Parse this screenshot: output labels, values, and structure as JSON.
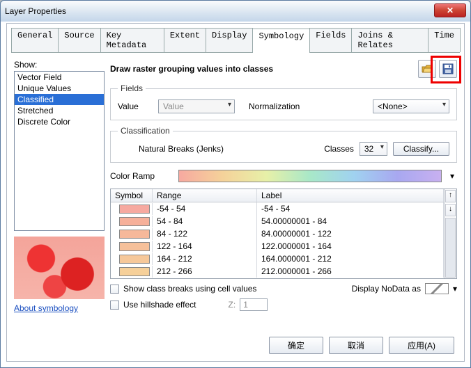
{
  "window": {
    "title": "Layer Properties"
  },
  "tabs": [
    "General",
    "Source",
    "Key Metadata",
    "Extent",
    "Display",
    "Symbology",
    "Fields",
    "Joins & Relates",
    "Time"
  ],
  "active_tab_index": 5,
  "show": {
    "label": "Show:",
    "items": [
      "Vector Field",
      "Unique Values",
      "Classified",
      "Stretched",
      "Discrete Color"
    ],
    "selected_index": 2
  },
  "about_link": "About symbology",
  "heading": "Draw raster grouping values into classes",
  "icons": {
    "open": "open-folder-icon",
    "save": "save-disk-icon"
  },
  "fields_group": {
    "legend": "Fields",
    "value_label": "Value",
    "value_selected": "Value",
    "normalization_label": "Normalization",
    "normalization_selected": "<None>"
  },
  "classification_group": {
    "legend": "Classification",
    "method": "Natural Breaks (Jenks)",
    "classes_label": "Classes",
    "classes_value": "32",
    "classify_button": "Classify..."
  },
  "color_ramp_label": "Color Ramp",
  "table": {
    "headers": {
      "symbol": "Symbol",
      "range": "Range",
      "label": "Label"
    },
    "rows": [
      {
        "color": "#f6a9a0",
        "range": "-54 - 54",
        "label": "-54 - 54"
      },
      {
        "color": "#f6b09a",
        "range": "54 - 84",
        "label": "54.00000001 - 84"
      },
      {
        "color": "#f6b89a",
        "range": "84 - 122",
        "label": "84.00000001 - 122"
      },
      {
        "color": "#f6c09a",
        "range": "122 - 164",
        "label": "122.0000001 - 164"
      },
      {
        "color": "#f6c89a",
        "range": "164 - 212",
        "label": "164.0000001 - 212"
      },
      {
        "color": "#f6d09a",
        "range": "212 - 266",
        "label": "212.0000001 - 266"
      }
    ]
  },
  "show_class_breaks_label": "Show class breaks using cell values",
  "use_hillshade_label": "Use hillshade effect",
  "z_label": "Z:",
  "z_value": "1",
  "display_nodata_label": "Display NoData as",
  "buttons": {
    "ok": "确定",
    "cancel": "取消",
    "apply": "应用(A)"
  }
}
